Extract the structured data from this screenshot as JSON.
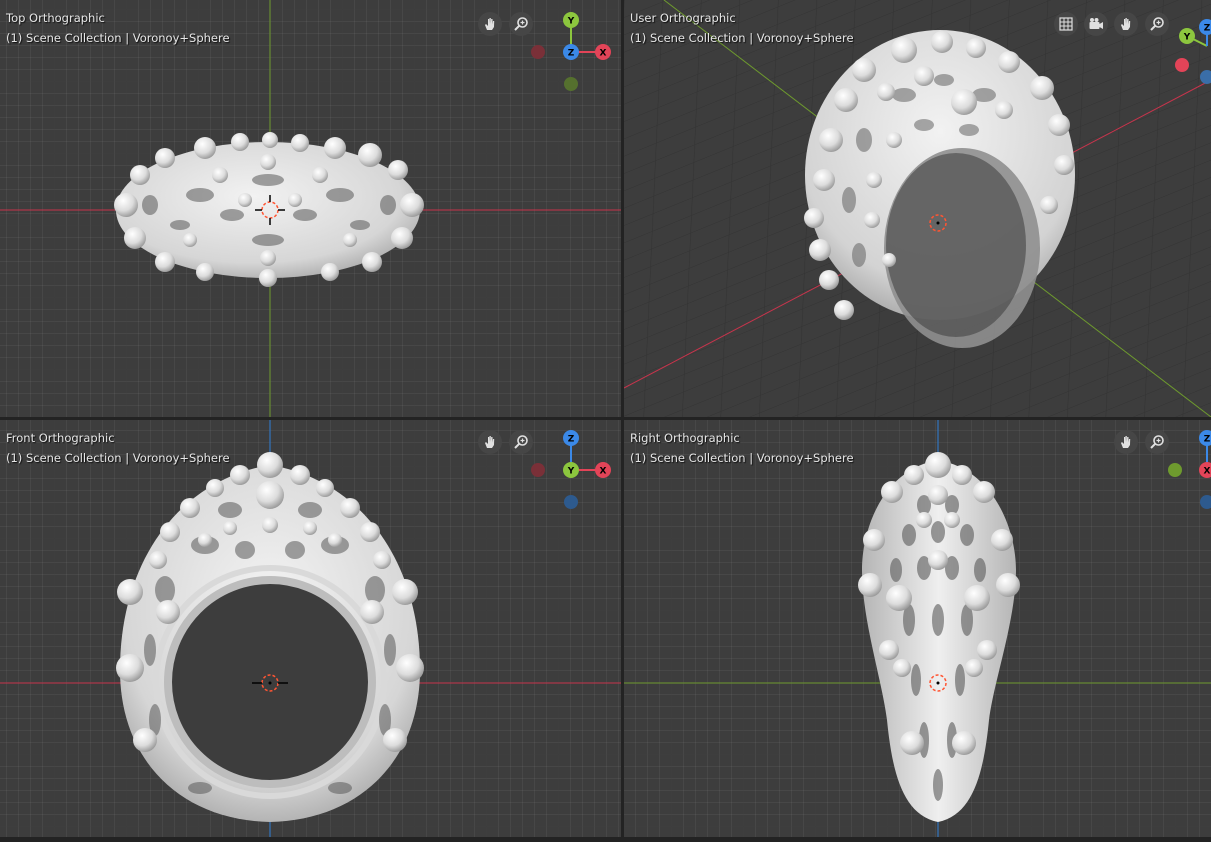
{
  "viewports": [
    {
      "id": "top",
      "view_name": "Top Orthographic",
      "scene": "(1) Scene Collection | Voronoy+Sphere",
      "gizmo": [
        "Y",
        "Z",
        "X"
      ]
    },
    {
      "id": "user",
      "view_name": "User Orthographic",
      "scene": "(1) Scene Collection | Voronoy+Sphere",
      "gizmo": [
        "Y",
        "Z"
      ]
    },
    {
      "id": "front",
      "view_name": "Front Orthographic",
      "scene": "(1) Scene Collection | Voronoy+Sphere",
      "gizmo": [
        "Z",
        "Y",
        "X"
      ]
    },
    {
      "id": "right",
      "view_name": "Right Orthographic",
      "scene": "(1) Scene Collection | Voronoy+Sphere",
      "gizmo": [
        "Z",
        "X"
      ]
    }
  ],
  "icons": {
    "pan": "hand-pan-icon",
    "zoom": "zoom-magnifier-icon",
    "camera": "camera-view-icon",
    "grid": "grid-toggle-icon",
    "cursor": "3d-cursor-icon"
  },
  "colors": {
    "viewport_bg": "#3d3d3d",
    "axis_x": "#c7344c",
    "axis_y": "#6e9a2e",
    "axis_z": "#2f7fd6",
    "gizmo_x": "#e34458",
    "gizmo_y": "#8cc63e",
    "gizmo_z": "#3b89e8",
    "model": "#e8e8e8"
  }
}
